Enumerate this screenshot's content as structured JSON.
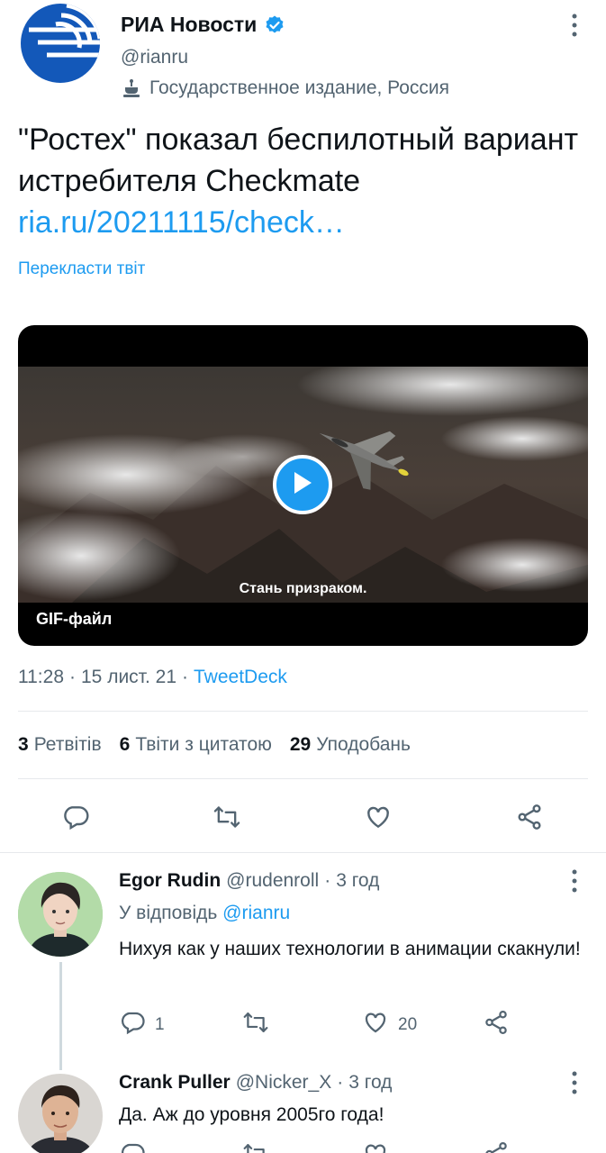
{
  "account": {
    "name": "РИА Новости",
    "handle": "@rianru",
    "label": "Государственное издание, Россия"
  },
  "tweet": {
    "text": "\"Ростех\" показал беспилотный вариант истребителя Checkmate",
    "link": "ria.ru/20211115/check…",
    "translate": "Перекласти твіт",
    "media": {
      "subtitle": "Стань призраком.",
      "badge": "GIF-файл"
    },
    "time": "11:28",
    "date": "15 лист. 21",
    "source": "TweetDeck",
    "stats": {
      "retweets_count": "3",
      "retweets_label": "Ретвітів",
      "quotes_count": "6",
      "quotes_label": "Твіти з цитатою",
      "likes_count": "29",
      "likes_label": "Уподобань"
    }
  },
  "replies": [
    {
      "name": "Egor Rudin",
      "handle": "@rudenroll",
      "time": "3 год",
      "replying_prefix": "У відповідь",
      "replying_to": "@rianru",
      "text": "Нихуя как у наших технологии в анимации скакнули!",
      "reply_count": "1",
      "like_count": "20"
    },
    {
      "name": "Crank Puller",
      "handle": "@Nicker_X",
      "time": "3 год",
      "text": "Да. Аж до уровня 2005го года!"
    }
  ],
  "colors": {
    "accent": "#1d9bf0",
    "secondary_text": "#536471",
    "primary_text": "#0f1419"
  }
}
